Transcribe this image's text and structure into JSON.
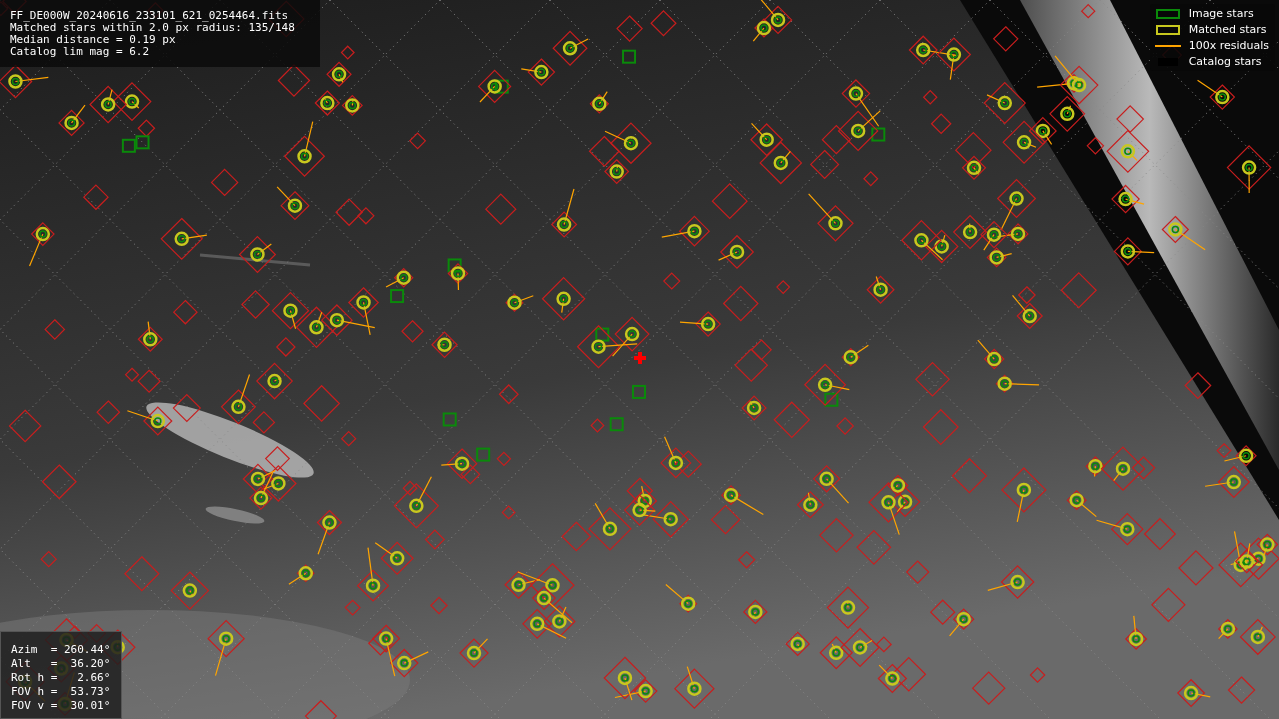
{
  "file_info": {
    "lines": [
      "FF_DE000W_20240616_233101_621_0254464.fits",
      "Matched stars within 2.0 px radius: 135/148",
      "Median distance = 0.19 px",
      "Catalog lim mag = 6.2"
    ]
  },
  "legend": {
    "items": [
      {
        "label": "Image stars",
        "kind": "box",
        "color": "#0a8a0a"
      },
      {
        "label": "Matched stars",
        "kind": "box",
        "color": "#c8c81e"
      },
      {
        "label": "100x residuals",
        "kind": "line",
        "color": "#ffa500"
      },
      {
        "label": "Catalog stars",
        "kind": "none",
        "color": "#000000"
      }
    ]
  },
  "pointing_info": {
    "lines": [
      "Azim  = 260.44°",
      "Alt   =  36.20°",
      "Rot h =   2.66°",
      "FOV h =  53.73°",
      "FOV v =  30.01°"
    ]
  }
}
